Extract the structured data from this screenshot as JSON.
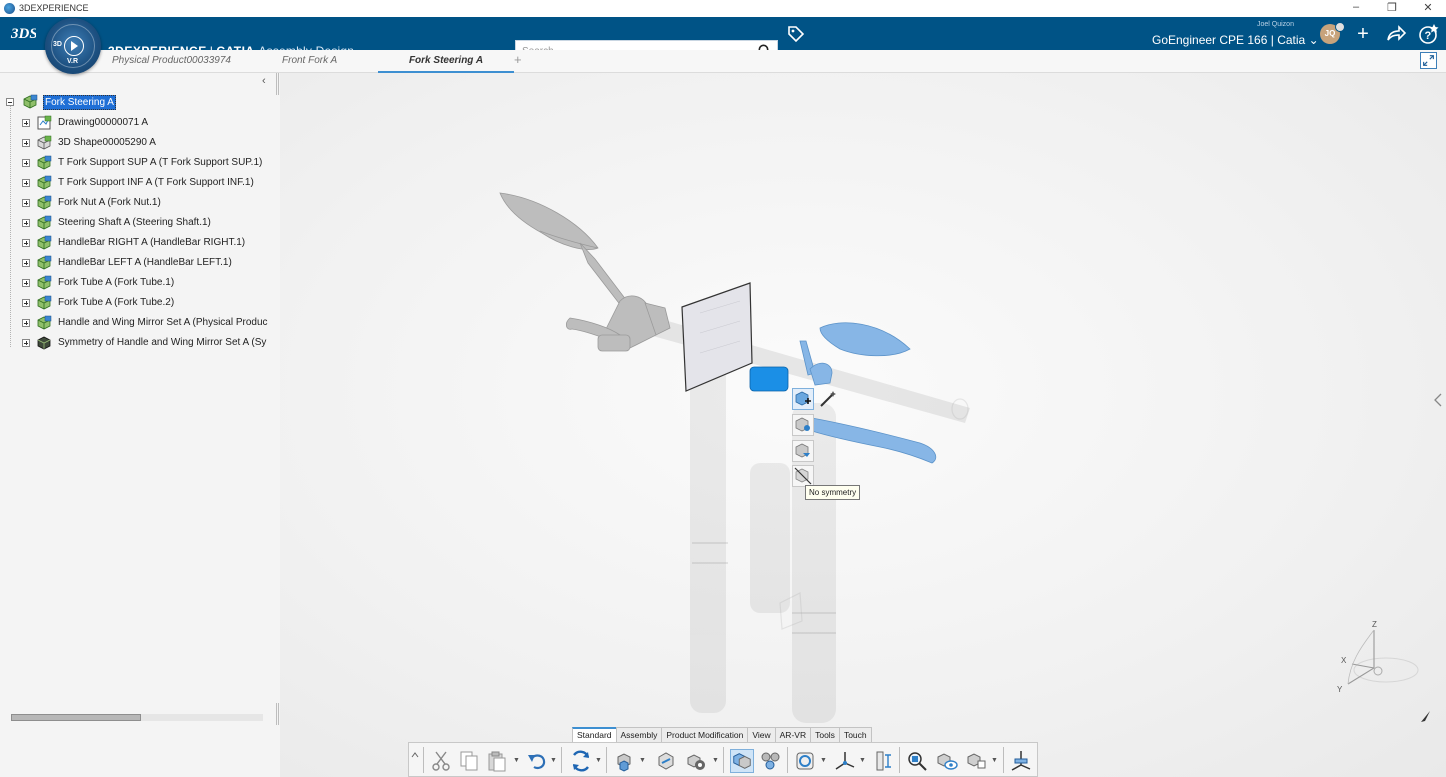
{
  "window": {
    "title": "3DEXPERIENCE"
  },
  "header": {
    "brand_3dx": "3DEXPERIENCE",
    "brand_sep": "|",
    "brand_catia": "CATIA",
    "brand_app": "Assembly Design",
    "compass_version": "V.R",
    "compass_3d": "3D",
    "search_placeholder": "Search",
    "user_name": "Joel Quizon",
    "user_initials": "JQ",
    "tenant": "GoEngineer CPE 166 | Catia"
  },
  "tabs": [
    {
      "label": "Physical Product00033974",
      "active": false
    },
    {
      "label": "Front Fork A",
      "active": false
    },
    {
      "label": "Fork Steering A",
      "active": true
    }
  ],
  "tree": {
    "root": "Fork Steering A",
    "items": [
      {
        "label": "Drawing00000071 A",
        "icon": "drawing-icon"
      },
      {
        "label": "3D Shape00005290 A",
        "icon": "3d-shape-icon"
      },
      {
        "label": "T Fork Support SUP A (T Fork Support SUP.1)",
        "icon": "physical-product-icon"
      },
      {
        "label": "T Fork Support INF A (T Fork Support INF.1)",
        "icon": "physical-product-icon"
      },
      {
        "label": "Fork Nut A (Fork Nut.1)",
        "icon": "physical-product-icon"
      },
      {
        "label": "Steering Shaft A (Steering Shaft.1)",
        "icon": "physical-product-icon"
      },
      {
        "label": "HandleBar RIGHT A (HandleBar RIGHT.1)",
        "icon": "physical-product-icon"
      },
      {
        "label": "HandleBar LEFT A (HandleBar LEFT.1)",
        "icon": "physical-product-icon"
      },
      {
        "label": "Fork Tube A (Fork Tube.1)",
        "icon": "physical-product-icon"
      },
      {
        "label": "Fork Tube A (Fork Tube.2)",
        "icon": "physical-product-icon"
      },
      {
        "label": "Handle and Wing Mirror Set A (Physical Produc",
        "icon": "physical-product-icon"
      },
      {
        "label": "Symmetry of Handle and Wing Mirror Set A (Sy",
        "icon": "symmetry-icon"
      }
    ]
  },
  "context_menu": {
    "tooltip": "No symmetry"
  },
  "triad": {
    "z": "Z",
    "x": "X",
    "y": "Y"
  },
  "toolbar_tabs": [
    {
      "label": "Standard",
      "active": true
    },
    {
      "label": "Assembly",
      "active": false
    },
    {
      "label": "Product Modification",
      "active": false
    },
    {
      "label": "View",
      "active": false
    },
    {
      "label": "AR-VR",
      "active": false
    },
    {
      "label": "Tools",
      "active": false
    },
    {
      "label": "Touch",
      "active": false
    }
  ],
  "colors": {
    "header_bg": "#005386",
    "selection": "#1f6fd6",
    "accent_tab": "#3d8fd1",
    "part_blue": "#7fb3e8"
  }
}
